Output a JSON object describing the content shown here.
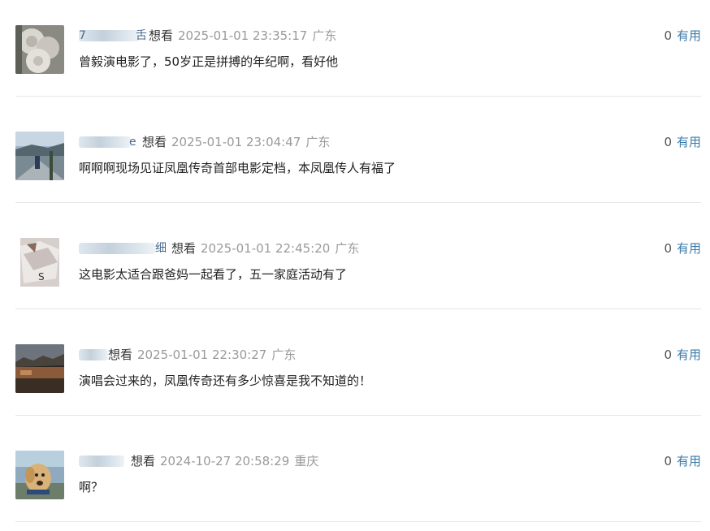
{
  "comments": [
    {
      "user_visible": [
        "7",
        "舌"
      ],
      "status": "想看",
      "time": "2025-01-01 23:35:17",
      "location": "广东",
      "text": "曾毅演电影了，50岁正是拼搏的年纪啊，看好他",
      "votes": "0",
      "useful": "有用"
    },
    {
      "user_visible": [
        "",
        "e"
      ],
      "status": "想看",
      "time": "2025-01-01 23:04:47",
      "location": "广东",
      "text": "啊啊啊现场见证凤凰传奇首部电影定档，本凤凰传人有福了",
      "votes": "0",
      "useful": "有用"
    },
    {
      "user_visible": [
        "",
        "细"
      ],
      "status": "想看",
      "time": "2025-01-01 22:45:20",
      "location": "广东",
      "text": "这电影太适合跟爸妈一起看了，五一家庭活动有了",
      "votes": "0",
      "useful": "有用"
    },
    {
      "user_visible": [
        "",
        ""
      ],
      "status": "想看",
      "time": "2025-01-01 22:30:27",
      "location": "广东",
      "text": "演唱会过来的，凤凰传奇还有多少惊喜是我不知道的！",
      "votes": "0",
      "useful": "有用"
    },
    {
      "user_visible": [
        "",
        ""
      ],
      "status": "想看",
      "time": "2024-10-27 20:58:29",
      "location": "重庆",
      "text": "啊？",
      "votes": "0",
      "useful": "有用"
    }
  ]
}
